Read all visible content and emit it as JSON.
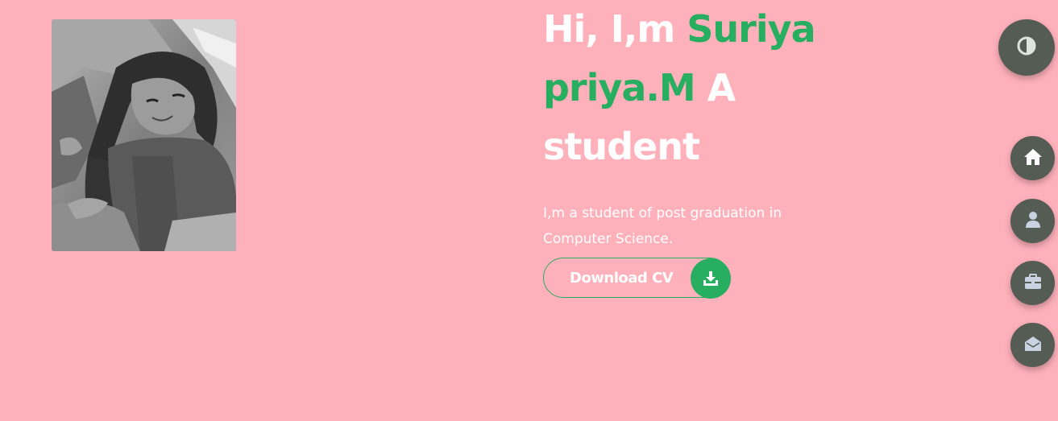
{
  "hero": {
    "greeting": "Hi, I,m ",
    "name": "Suriya priya.M",
    "role_suffix": " A student",
    "description": "I,m a student of post graduation in Computer Science."
  },
  "cta": {
    "download_label": "Download CV",
    "icon": "download-icon"
  },
  "controls": {
    "theme_icon": "contrast-icon",
    "nav": [
      {
        "id": "home",
        "icon": "home-icon"
      },
      {
        "id": "about",
        "icon": "user-icon"
      },
      {
        "id": "portfolio",
        "icon": "briefcase-icon"
      },
      {
        "id": "contact",
        "icon": "envelope-open-icon"
      }
    ]
  },
  "colors": {
    "background": "#ffb1bb",
    "accent": "#27ae60",
    "control_bg": "#545c54",
    "text": "#ffffff"
  }
}
